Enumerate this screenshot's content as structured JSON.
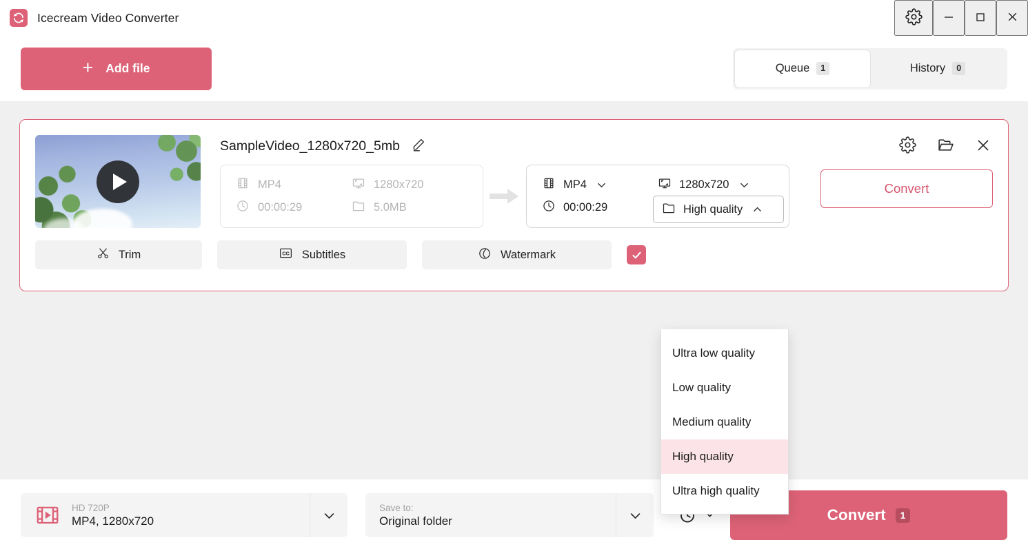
{
  "window": {
    "title": "Icecream Video Converter",
    "logo_icon": "refresh-circular-arrows-icon",
    "settings_icon": "gear-icon",
    "minimize_icon": "minimize-icon",
    "maximize_icon": "maximize-icon",
    "close_icon": "close-icon",
    "accent_color": "#dd6277",
    "background_color": "#f0f0f0"
  },
  "toolbar": {
    "add_file_label": "Add file",
    "add_file_icon": "plus-icon",
    "tabs": [
      {
        "label": "Queue",
        "badge": "1",
        "active": true
      },
      {
        "label": "History",
        "badge": "0",
        "active": false
      }
    ]
  },
  "file_card": {
    "filename": "SampleVideo_1280x720_5mb",
    "edit_icon": "pencil-icon",
    "thumbnail_play_icon": "play-icon",
    "source": {
      "format": {
        "icon": "film-strip-icon",
        "value": "MP4"
      },
      "resolution": {
        "icon": "monitor-icon",
        "value": "1280x720"
      },
      "duration": {
        "icon": "clock-icon",
        "value": "00:00:29"
      },
      "size": {
        "icon": "folder-icon",
        "value": "5.0MB"
      }
    },
    "arrow_icon": "arrow-right-icon",
    "output": {
      "format": {
        "icon": "film-strip-icon",
        "value": "MP4",
        "chevron": "chevron-down-icon"
      },
      "resolution": {
        "icon": "monitor-icon",
        "value": "1280x720",
        "chevron": "chevron-down-icon"
      },
      "duration": {
        "icon": "clock-icon",
        "value": "00:00:29"
      },
      "quality": {
        "icon": "folder-icon",
        "value": "High quality",
        "chevron": "chevron-up-icon",
        "open": true
      }
    },
    "convert_label": "Convert",
    "card_icons": [
      "gear-icon",
      "open-folder-icon",
      "close-icon"
    ],
    "actions": [
      {
        "label": "Trim",
        "icon": "scissors-icon"
      },
      {
        "label": "Subtitles",
        "icon": "closed-caption-icon"
      },
      {
        "label": "Watermark",
        "icon": "watermark-droplet-icon"
      }
    ],
    "checkbox_checked": true
  },
  "quality_menu": {
    "options": [
      {
        "label": "Ultra low quality",
        "selected": false
      },
      {
        "label": "Low quality",
        "selected": false
      },
      {
        "label": "Medium quality",
        "selected": false
      },
      {
        "label": "High quality",
        "selected": true
      },
      {
        "label": "Ultra high quality",
        "selected": false
      }
    ],
    "highlight_color": "#fbe3e7"
  },
  "bottom_bar": {
    "preset": {
      "icon": "film-play-icon",
      "small_label": "HD 720P",
      "big_label": "MP4, 1280x720",
      "chevron": "chevron-down-icon"
    },
    "save_to": {
      "small_label": "Save to:",
      "big_label": "Original folder",
      "chevron": "chevron-down-icon"
    },
    "timer": {
      "icon": "alarm-clock-icon",
      "chevron": "chevron-down-icon"
    },
    "convert": {
      "label": "Convert",
      "badge": "1"
    }
  }
}
